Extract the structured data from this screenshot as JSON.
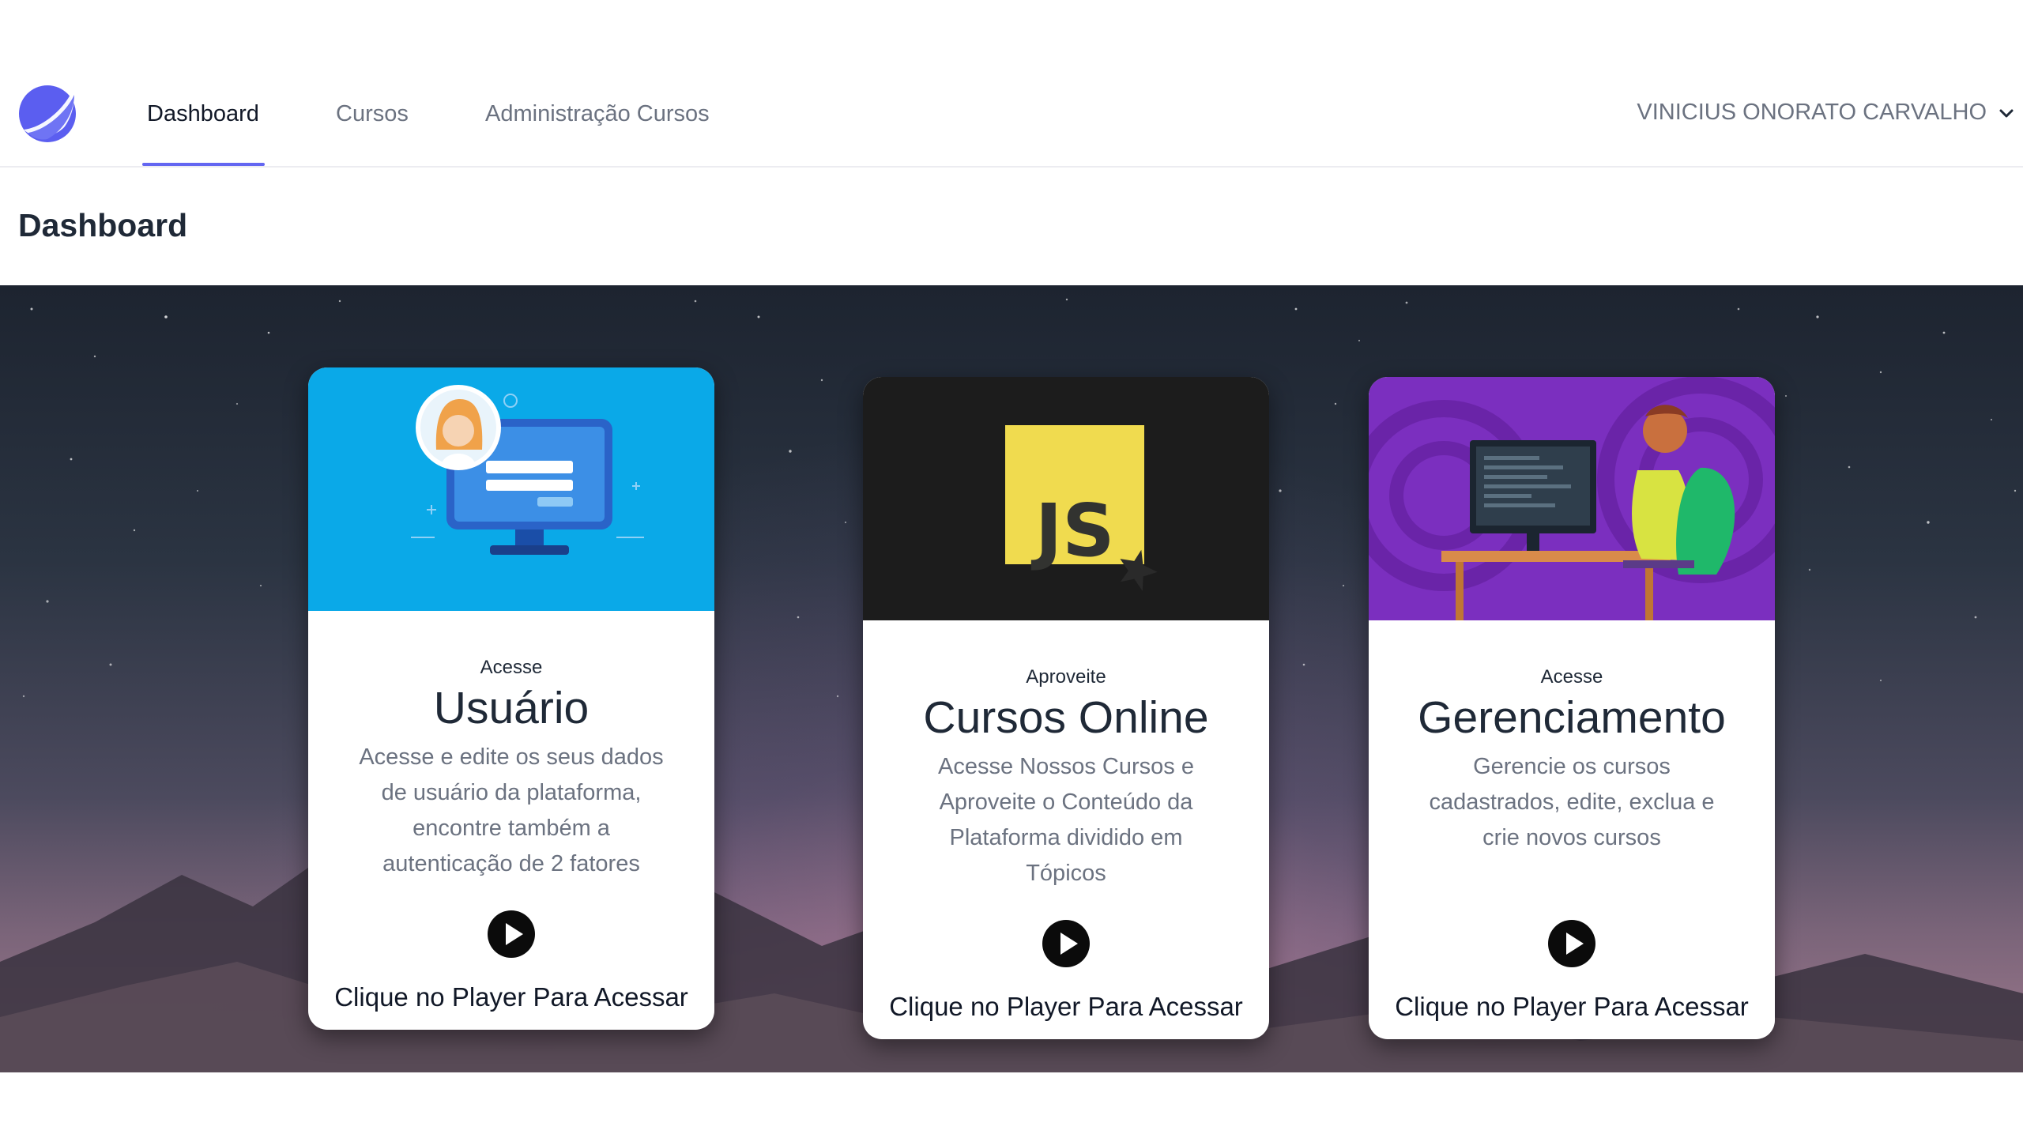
{
  "nav": {
    "items": [
      {
        "label": "Dashboard",
        "active": true
      },
      {
        "label": "Cursos",
        "active": false
      },
      {
        "label": "Administração Cursos",
        "active": false
      }
    ],
    "user_name": "VINICIUS ONORATO CARVALHO"
  },
  "page": {
    "title": "Dashboard"
  },
  "cards": [
    {
      "kicker": "Acesse",
      "title": "Usuário",
      "description": "Acesse e edite os seus dados de usuário da plataforma, encontre também a autenticação de 2 fatores",
      "cta": "Clique no Player Para Acessar",
      "media_color": "#0aa9e8"
    },
    {
      "kicker": "Aproveite",
      "title": "Cursos Online",
      "description": "Acesse Nossos Cursos e Aproveite o Conteúdo da Plataforma dividido em Tópicos",
      "cta": "Clique no Player Para Acessar",
      "media_color": "#1c1c1c",
      "media_text": "JS"
    },
    {
      "kicker": "Acesse",
      "title": "Gerenciamento",
      "description": "Gerencie os cursos cadastrados, edite, exclua e crie novos cursos",
      "cta": "Clique no Player Para Acessar",
      "media_color": "#7b2fbf"
    }
  ],
  "colors": {
    "accent": "#6366f1",
    "logo": "#5b5ef0"
  }
}
